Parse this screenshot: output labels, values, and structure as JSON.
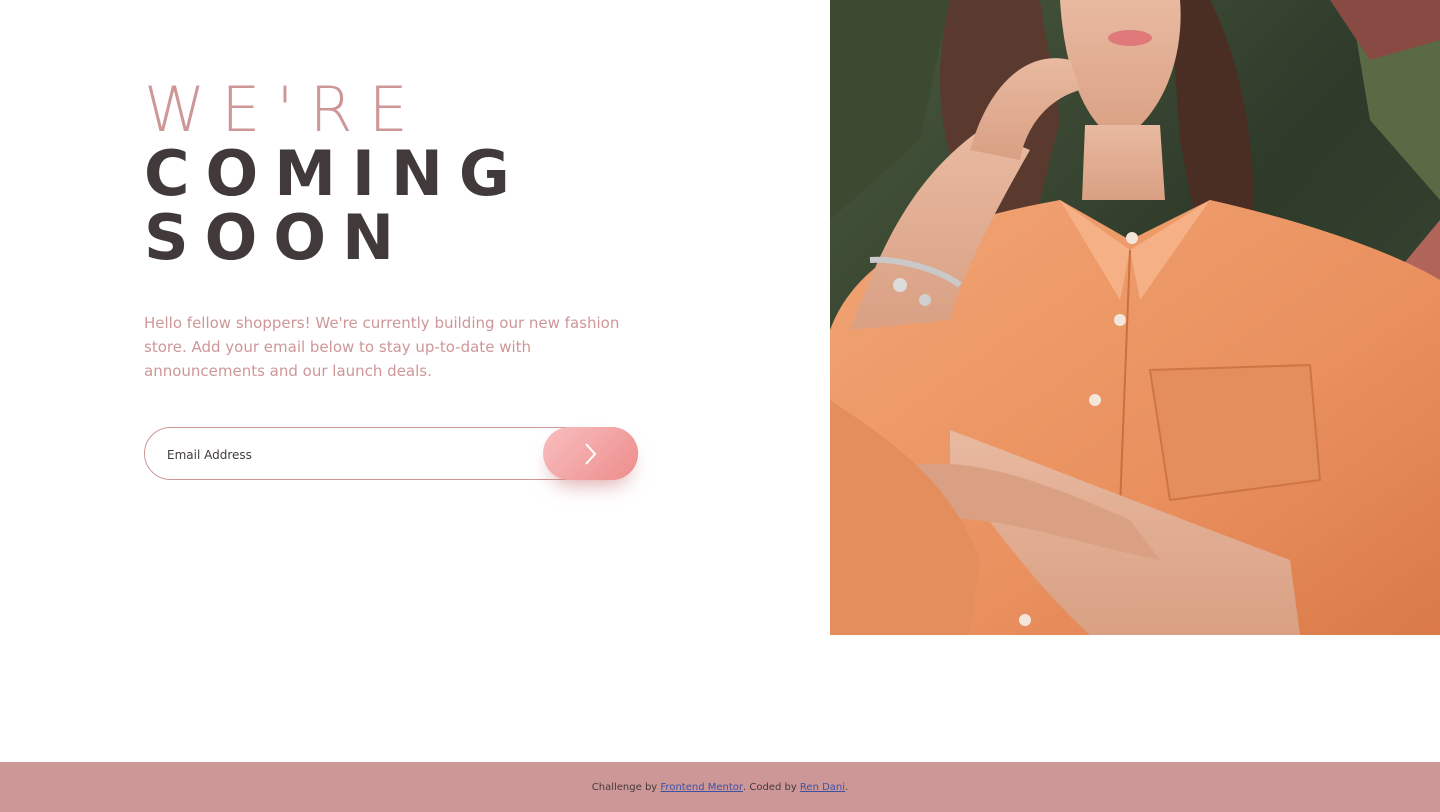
{
  "hero": {
    "headline_line1": "We're",
    "headline_line2": "coming",
    "headline_line3": "soon",
    "intro": "Hello fellow shoppers! We're currently building our new fashion store. Add your email below to stay up-to-date with announcements and our launch deals."
  },
  "signup": {
    "email_placeholder": "Email Address",
    "submit_icon": "chevron-right-icon"
  },
  "image": {
    "subject": "hero-photo"
  },
  "footer": {
    "prefix": "Challenge by ",
    "challenge_link": "Frontend Mentor",
    "middle": ". Coded by ",
    "author_link": "Ren Dani",
    "suffix": "."
  },
  "colors": {
    "accent_pink": "#ce9797",
    "dark_text": "#423a3a",
    "button_gradient_start": "#f8bfbf",
    "button_gradient_end": "#ee8c8c",
    "link_blue": "#3e52a3"
  }
}
